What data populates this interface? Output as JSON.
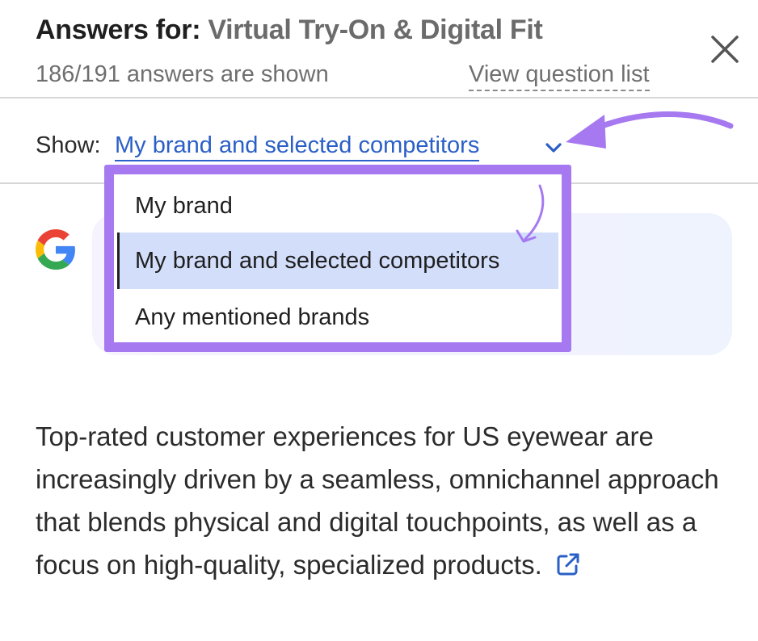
{
  "header": {
    "title_prefix": "Answers for:",
    "title_topic": "Virtual Try-On & Digital Fit",
    "answers_count": "186/191 answers are shown",
    "view_question_list": "View question list"
  },
  "filter": {
    "show_label": "Show:",
    "selected_value": "My brand and selected competitors",
    "options": [
      {
        "label": "My brand",
        "selected": false
      },
      {
        "label": "My brand and selected competitors",
        "selected": true
      },
      {
        "label": "Any mentioned brands",
        "selected": false
      }
    ]
  },
  "answer": {
    "source_icon": "google-icon",
    "text": "Top-rated customer experiences for US eyewear are increasingly driven by a seamless, omnichannel approach that blends physical and digital touchpoints, as well as a focus on high-quality, specialized products."
  },
  "colors": {
    "accent_purple": "#a679f0",
    "link_blue": "#2a5fc7",
    "selected_bg": "#d3defb"
  },
  "icons": [
    "close-icon",
    "chevron-down-icon",
    "google-icon",
    "external-link-icon",
    "annotation-arrow-icon"
  ]
}
